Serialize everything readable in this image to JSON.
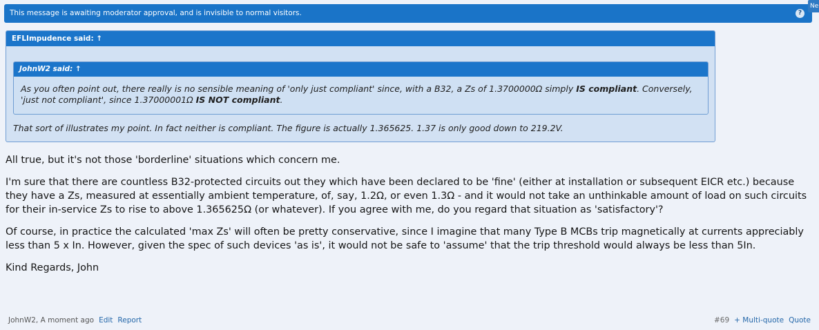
{
  "notice": {
    "text": "This message is awaiting moderator approval, and is invisible to normal visitors.",
    "help_glyph": "?",
    "new_tab_label": "Ne"
  },
  "outer_quote": {
    "author_label": "EFLImpudence said: ↑",
    "text": "That sort of illustrates my point. In fact neither is compliant. The figure is actually 1.365625. 1.37 is only good down to 219.2V."
  },
  "inner_quote": {
    "author_label": "JohnW2 said: ↑",
    "text_a": "As you often point out, there really is no sensible meaning of 'only just compliant' since, with a B32, a Zs of 1.3700000Ω simply ",
    "bold_a": "IS compliant",
    "text_b": ". Conversely, 'just not compliant', since 1.37000001Ω ",
    "bold_b": "IS NOT compliant",
    "text_c": "."
  },
  "post": {
    "paragraphs": [
      "All true, but it's not those 'borderline' situations which concern me.",
      "I'm sure that there are countless B32-protected circuits out they which have been declared to be 'fine' (either at installation or subsequent EICR etc.) because they have a Zs, measured at essentially ambient temperature, of, say, 1.2Ω, or even 1.3Ω - and it would not take an unthinkable amount of load on such circuits for their in-service Zs to rise to above 1.365625Ω (or whatever). If you agree with me, do you regard that situation as 'satisfactory'?",
      "Of course, in practice the calculated 'max Zs' will often be pretty conservative, since I imagine that many Type B MCBs trip magnetically at currents appreciably less than 5 x In. However, given the spec of such devices 'as is', it would not be safe to 'assume' that the trip threshold would always be less than 5In.",
      "Kind Regards, John"
    ]
  },
  "footer": {
    "author_time": "JohnW2, A moment ago",
    "edit": "Edit",
    "report": "Report",
    "post_number": "#69",
    "multi_quote": "+ Multi-quote",
    "quote": "Quote"
  }
}
